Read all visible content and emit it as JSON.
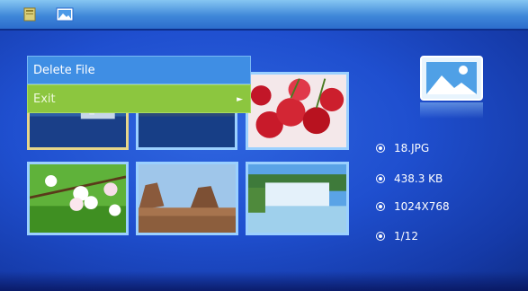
{
  "topbar": {
    "icons": [
      "folder-icon",
      "photo-icon"
    ]
  },
  "context_menu": {
    "items": [
      {
        "label": "Delete File",
        "state": "normal"
      },
      {
        "label": "Exit",
        "state": "highlighted",
        "arrow": "►"
      }
    ]
  },
  "thumbnails": [
    {
      "subject": "harbor",
      "selected": true
    },
    {
      "subject": "lake",
      "selected": false
    },
    {
      "subject": "cherries",
      "selected": false
    },
    {
      "subject": "blossoms",
      "selected": false
    },
    {
      "subject": "canyon",
      "selected": false
    },
    {
      "subject": "waterfall",
      "selected": false
    }
  ],
  "preview_icon": "image-icon",
  "file_info": {
    "name": "18.JPG",
    "size": "438.3 KB",
    "resolution": "1024X768",
    "index": "1/12"
  },
  "colors": {
    "menu_highlight": "#8cc63f",
    "menu_normal": "#3f8ee4",
    "thumb_border": "#9bd0ff"
  }
}
